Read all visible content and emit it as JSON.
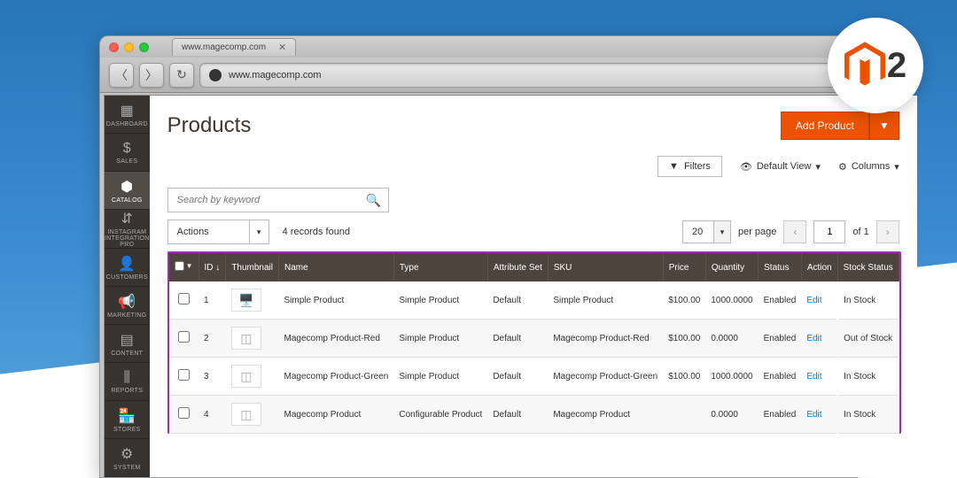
{
  "browser": {
    "tab_label": "www.magecomp.com",
    "url": "www.magecomp.com"
  },
  "logo": {
    "num": "2"
  },
  "sidebar": {
    "items": [
      {
        "label": "DASHBOARD",
        "icon": "▦"
      },
      {
        "label": "SALES",
        "icon": "$"
      },
      {
        "label": "CATALOG",
        "icon": "⬢"
      },
      {
        "label": "INSTAGRAM INTEGRATION PRO",
        "icon": "⇵"
      },
      {
        "label": "CUSTOMERS",
        "icon": "👤"
      },
      {
        "label": "MARKETING",
        "icon": "📢"
      },
      {
        "label": "CONTENT",
        "icon": "▤"
      },
      {
        "label": "REPORTS",
        "icon": "⫼"
      },
      {
        "label": "STORES",
        "icon": "🏪"
      },
      {
        "label": "SYSTEM",
        "icon": "⚙"
      }
    ]
  },
  "page": {
    "title": "Products",
    "add_btn": "Add Product",
    "filters_btn": "Filters",
    "default_view": "Default View",
    "columns_btn": "Columns",
    "search_ph": "Search by keyword",
    "actions_label": "Actions",
    "records": "4 records found",
    "per_page_val": "20",
    "per_page_label": "per page",
    "page_input": "1",
    "of_pages": "of 1"
  },
  "grid": {
    "headers": {
      "id": "ID ↓",
      "thumb": "Thumbnail",
      "name": "Name",
      "type": "Type",
      "attrset": "Attribute Set",
      "sku": "SKU",
      "price": "Price",
      "qty": "Quantity",
      "status": "Status",
      "action": "Action",
      "stock": "Stock Status"
    },
    "rows": [
      {
        "id": "1",
        "name": "Simple Product",
        "type": "Simple Product",
        "attrset": "Default",
        "sku": "Simple Product",
        "price": "$100.00",
        "qty": "1000.0000",
        "status": "Enabled",
        "action": "Edit",
        "stock": "In Stock"
      },
      {
        "id": "2",
        "name": "Magecomp Product-Red",
        "type": "Simple Product",
        "attrset": "Default",
        "sku": "Magecomp Product-Red",
        "price": "$100.00",
        "qty": "0.0000",
        "status": "Enabled",
        "action": "Edit",
        "stock": "Out of Stock"
      },
      {
        "id": "3",
        "name": "Magecomp Product-Green",
        "type": "Simple Product",
        "attrset": "Default",
        "sku": "Magecomp Product-Green",
        "price": "$100.00",
        "qty": "1000.0000",
        "status": "Enabled",
        "action": "Edit",
        "stock": "In Stock"
      },
      {
        "id": "4",
        "name": "Magecomp Product",
        "type": "Configurable Product",
        "attrset": "Default",
        "sku": "Magecomp Product",
        "price": "",
        "qty": "0.0000",
        "status": "Enabled",
        "action": "Edit",
        "stock": "In Stock"
      }
    ]
  }
}
